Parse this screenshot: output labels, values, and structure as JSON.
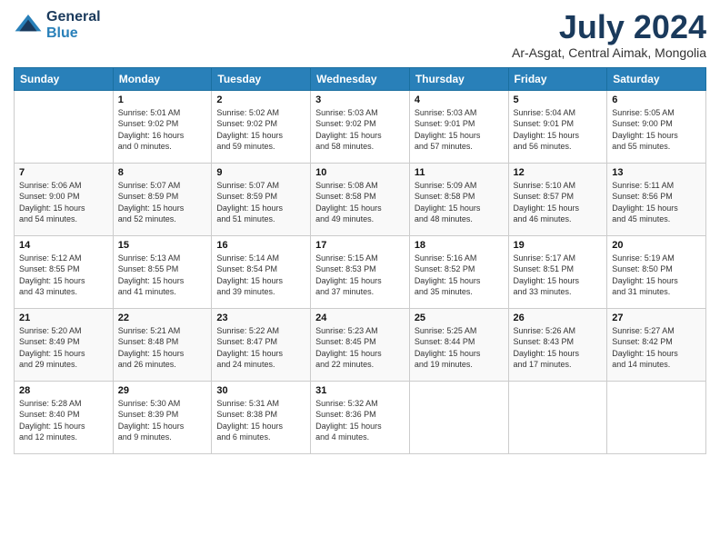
{
  "logo": {
    "general": "General",
    "blue": "Blue"
  },
  "title": "July 2024",
  "location": "Ar-Asgat, Central Aimak, Mongolia",
  "days_of_week": [
    "Sunday",
    "Monday",
    "Tuesday",
    "Wednesday",
    "Thursday",
    "Friday",
    "Saturday"
  ],
  "weeks": [
    [
      {
        "day": "",
        "info": ""
      },
      {
        "day": "1",
        "info": "Sunrise: 5:01 AM\nSunset: 9:02 PM\nDaylight: 16 hours\nand 0 minutes."
      },
      {
        "day": "2",
        "info": "Sunrise: 5:02 AM\nSunset: 9:02 PM\nDaylight: 15 hours\nand 59 minutes."
      },
      {
        "day": "3",
        "info": "Sunrise: 5:03 AM\nSunset: 9:02 PM\nDaylight: 15 hours\nand 58 minutes."
      },
      {
        "day": "4",
        "info": "Sunrise: 5:03 AM\nSunset: 9:01 PM\nDaylight: 15 hours\nand 57 minutes."
      },
      {
        "day": "5",
        "info": "Sunrise: 5:04 AM\nSunset: 9:01 PM\nDaylight: 15 hours\nand 56 minutes."
      },
      {
        "day": "6",
        "info": "Sunrise: 5:05 AM\nSunset: 9:00 PM\nDaylight: 15 hours\nand 55 minutes."
      }
    ],
    [
      {
        "day": "7",
        "info": "Sunrise: 5:06 AM\nSunset: 9:00 PM\nDaylight: 15 hours\nand 54 minutes."
      },
      {
        "day": "8",
        "info": "Sunrise: 5:07 AM\nSunset: 8:59 PM\nDaylight: 15 hours\nand 52 minutes."
      },
      {
        "day": "9",
        "info": "Sunrise: 5:07 AM\nSunset: 8:59 PM\nDaylight: 15 hours\nand 51 minutes."
      },
      {
        "day": "10",
        "info": "Sunrise: 5:08 AM\nSunset: 8:58 PM\nDaylight: 15 hours\nand 49 minutes."
      },
      {
        "day": "11",
        "info": "Sunrise: 5:09 AM\nSunset: 8:58 PM\nDaylight: 15 hours\nand 48 minutes."
      },
      {
        "day": "12",
        "info": "Sunrise: 5:10 AM\nSunset: 8:57 PM\nDaylight: 15 hours\nand 46 minutes."
      },
      {
        "day": "13",
        "info": "Sunrise: 5:11 AM\nSunset: 8:56 PM\nDaylight: 15 hours\nand 45 minutes."
      }
    ],
    [
      {
        "day": "14",
        "info": "Sunrise: 5:12 AM\nSunset: 8:55 PM\nDaylight: 15 hours\nand 43 minutes."
      },
      {
        "day": "15",
        "info": "Sunrise: 5:13 AM\nSunset: 8:55 PM\nDaylight: 15 hours\nand 41 minutes."
      },
      {
        "day": "16",
        "info": "Sunrise: 5:14 AM\nSunset: 8:54 PM\nDaylight: 15 hours\nand 39 minutes."
      },
      {
        "day": "17",
        "info": "Sunrise: 5:15 AM\nSunset: 8:53 PM\nDaylight: 15 hours\nand 37 minutes."
      },
      {
        "day": "18",
        "info": "Sunrise: 5:16 AM\nSunset: 8:52 PM\nDaylight: 15 hours\nand 35 minutes."
      },
      {
        "day": "19",
        "info": "Sunrise: 5:17 AM\nSunset: 8:51 PM\nDaylight: 15 hours\nand 33 minutes."
      },
      {
        "day": "20",
        "info": "Sunrise: 5:19 AM\nSunset: 8:50 PM\nDaylight: 15 hours\nand 31 minutes."
      }
    ],
    [
      {
        "day": "21",
        "info": "Sunrise: 5:20 AM\nSunset: 8:49 PM\nDaylight: 15 hours\nand 29 minutes."
      },
      {
        "day": "22",
        "info": "Sunrise: 5:21 AM\nSunset: 8:48 PM\nDaylight: 15 hours\nand 26 minutes."
      },
      {
        "day": "23",
        "info": "Sunrise: 5:22 AM\nSunset: 8:47 PM\nDaylight: 15 hours\nand 24 minutes."
      },
      {
        "day": "24",
        "info": "Sunrise: 5:23 AM\nSunset: 8:45 PM\nDaylight: 15 hours\nand 22 minutes."
      },
      {
        "day": "25",
        "info": "Sunrise: 5:25 AM\nSunset: 8:44 PM\nDaylight: 15 hours\nand 19 minutes."
      },
      {
        "day": "26",
        "info": "Sunrise: 5:26 AM\nSunset: 8:43 PM\nDaylight: 15 hours\nand 17 minutes."
      },
      {
        "day": "27",
        "info": "Sunrise: 5:27 AM\nSunset: 8:42 PM\nDaylight: 15 hours\nand 14 minutes."
      }
    ],
    [
      {
        "day": "28",
        "info": "Sunrise: 5:28 AM\nSunset: 8:40 PM\nDaylight: 15 hours\nand 12 minutes."
      },
      {
        "day": "29",
        "info": "Sunrise: 5:30 AM\nSunset: 8:39 PM\nDaylight: 15 hours\nand 9 minutes."
      },
      {
        "day": "30",
        "info": "Sunrise: 5:31 AM\nSunset: 8:38 PM\nDaylight: 15 hours\nand 6 minutes."
      },
      {
        "day": "31",
        "info": "Sunrise: 5:32 AM\nSunset: 8:36 PM\nDaylight: 15 hours\nand 4 minutes."
      },
      {
        "day": "",
        "info": ""
      },
      {
        "day": "",
        "info": ""
      },
      {
        "day": "",
        "info": ""
      }
    ]
  ]
}
